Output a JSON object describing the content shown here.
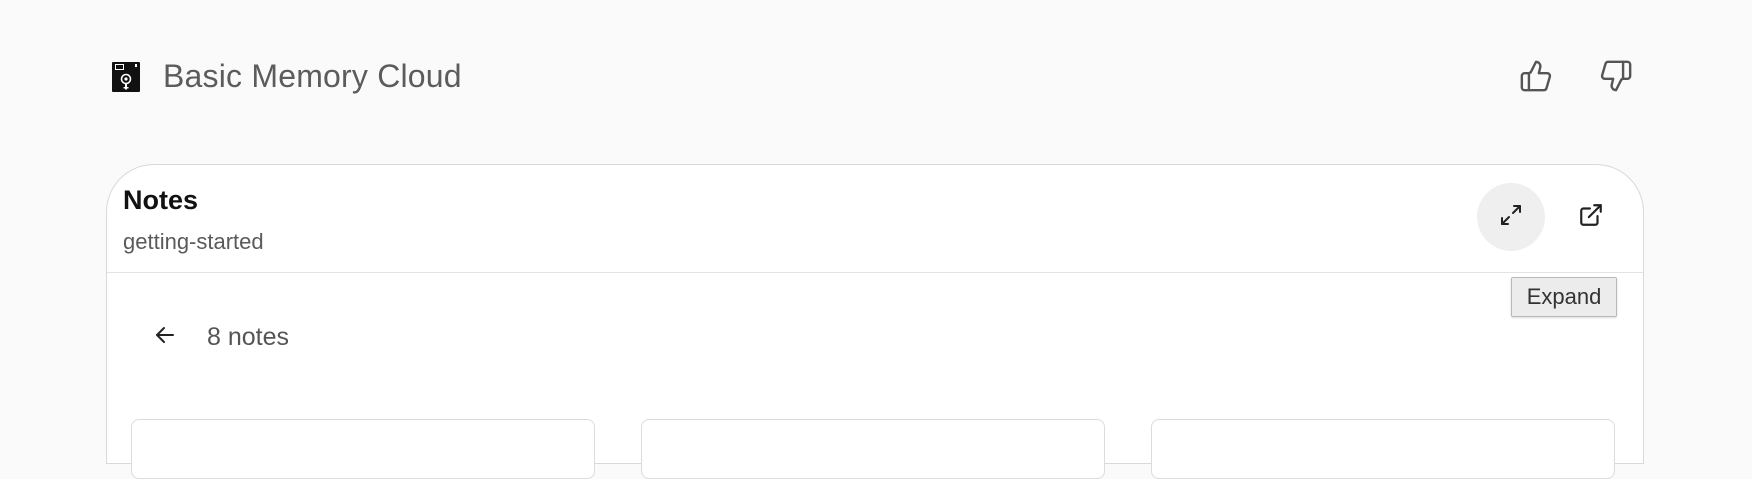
{
  "app": {
    "title": "Basic Memory Cloud",
    "logo_icon": "floppy-disk-icon"
  },
  "feedback": {
    "thumbs_up_icon": "thumbs-up-icon",
    "thumbs_down_icon": "thumbs-down-icon"
  },
  "card": {
    "title": "Notes",
    "subtitle": "getting-started",
    "expand_icon": "expand-icon",
    "open_external_icon": "external-link-icon",
    "tooltip": "Expand"
  },
  "notes": {
    "back_icon": "arrow-left-icon",
    "count_label": "8 notes"
  },
  "colors": {
    "background": "#fafafa",
    "card_background": "#ffffff",
    "border": "#d9d9d9",
    "expand_button_bg": "#efefef"
  }
}
